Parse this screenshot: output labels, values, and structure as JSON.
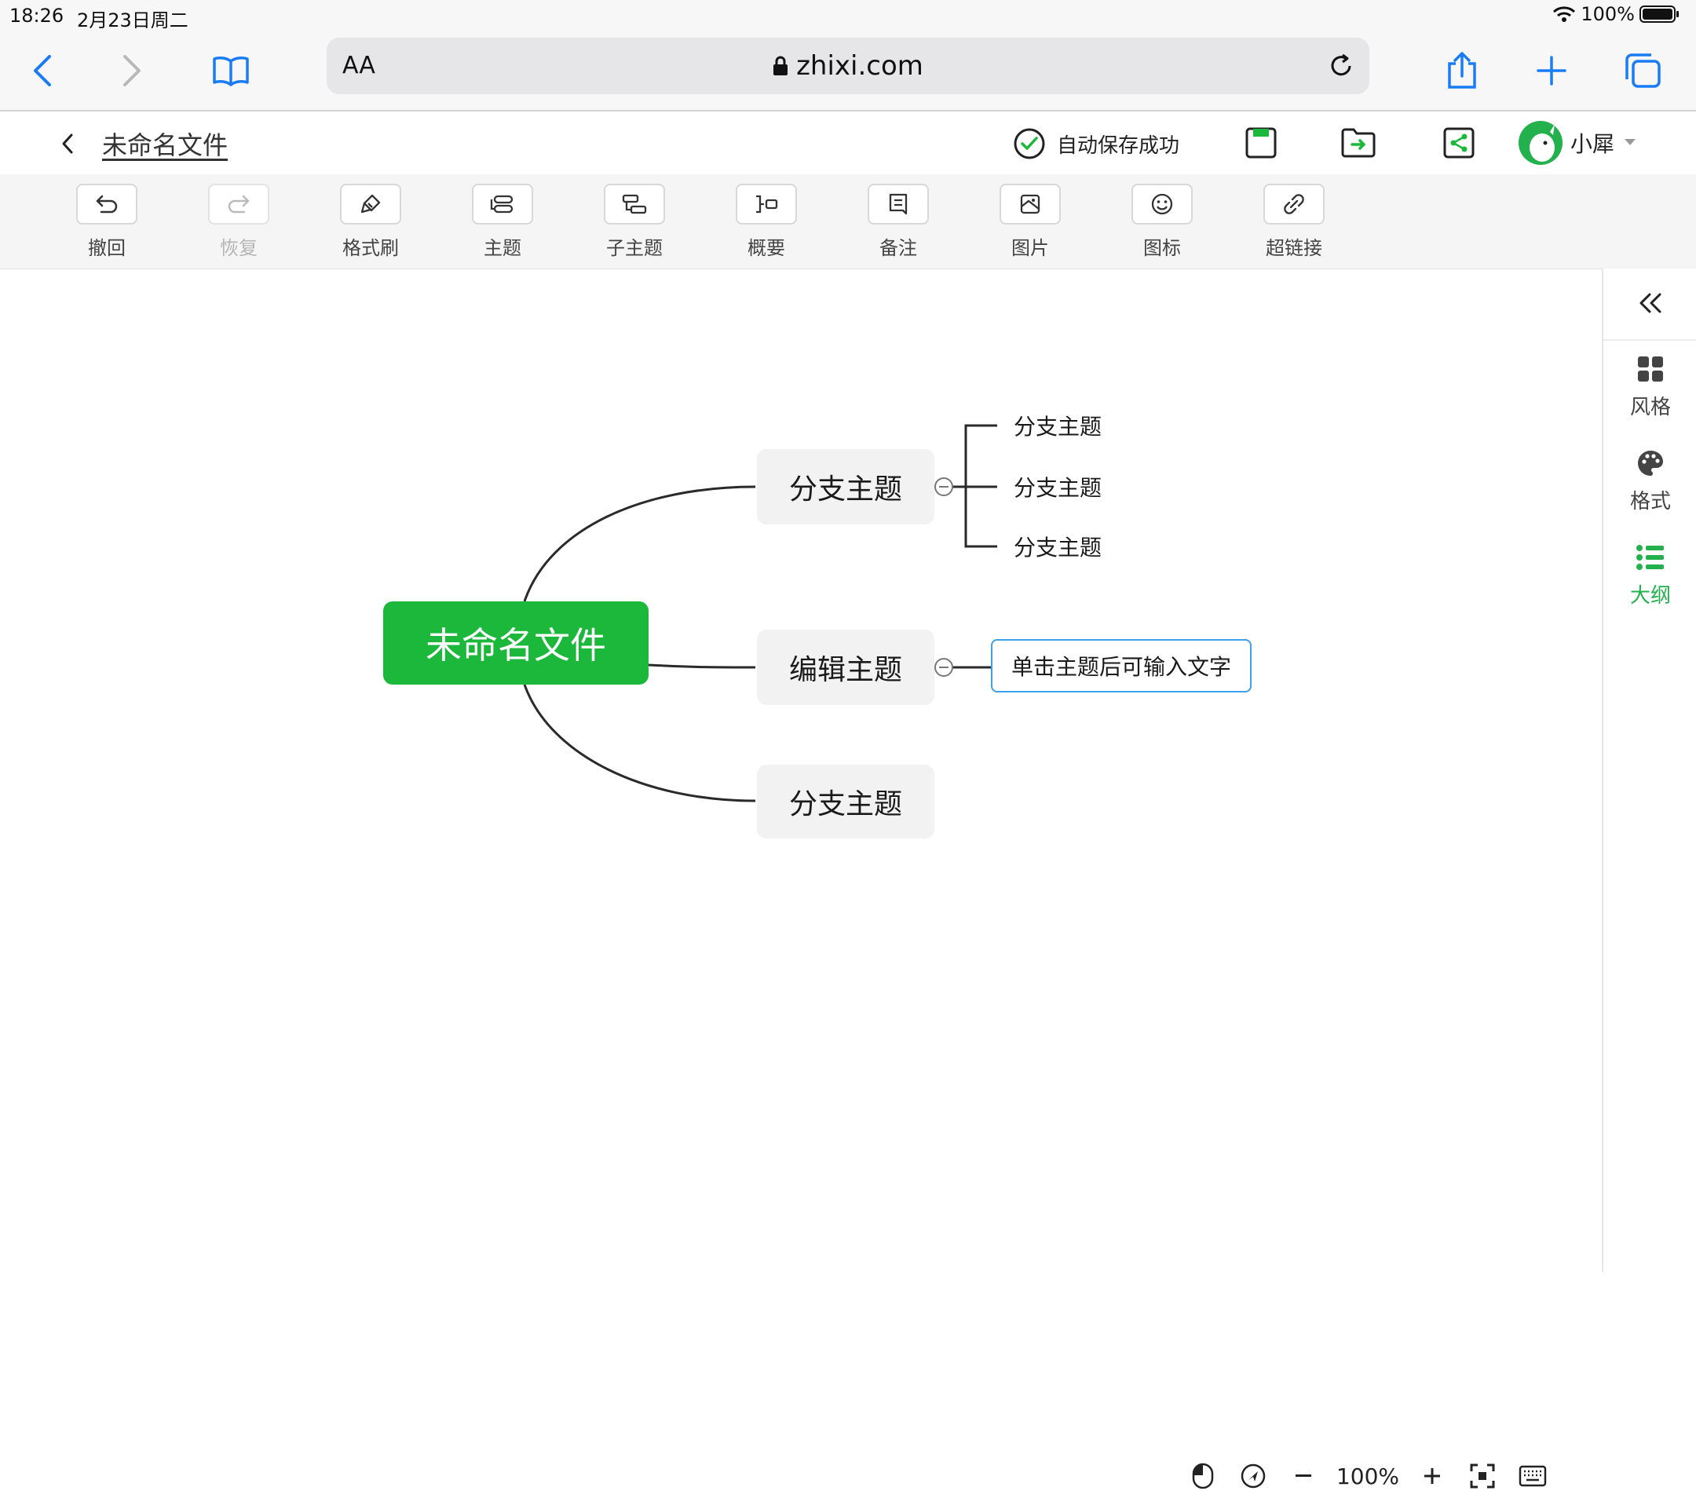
{
  "status_bar": {
    "time": "18:26",
    "date": "2月23日周二",
    "battery": "100%"
  },
  "browser": {
    "aa_label": "AA",
    "url": "zhixi.com"
  },
  "header": {
    "title": "未命名文件",
    "save_status": "自动保存成功",
    "user_name": "小犀"
  },
  "toolbar": {
    "items": [
      {
        "label": "撤回",
        "icon": "undo-icon",
        "enabled": true
      },
      {
        "label": "恢复",
        "icon": "redo-icon",
        "enabled": false
      },
      {
        "label": "格式刷",
        "icon": "format-brush-icon",
        "enabled": true
      },
      {
        "label": "主题",
        "icon": "topic-icon",
        "enabled": true
      },
      {
        "label": "子主题",
        "icon": "subtopic-icon",
        "enabled": true
      },
      {
        "label": "概要",
        "icon": "summary-icon",
        "enabled": true
      },
      {
        "label": "备注",
        "icon": "note-icon",
        "enabled": true
      },
      {
        "label": "图片",
        "icon": "image-icon",
        "enabled": true
      },
      {
        "label": "图标",
        "icon": "emoji-icon",
        "enabled": true
      },
      {
        "label": "超链接",
        "icon": "link-icon",
        "enabled": true
      }
    ]
  },
  "right_panel": {
    "items": [
      {
        "label": "风格",
        "icon": "grid-icon",
        "active": false
      },
      {
        "label": "格式",
        "icon": "palette-icon",
        "active": false
      },
      {
        "label": "大纲",
        "icon": "outline-icon",
        "active": true
      }
    ]
  },
  "mindmap": {
    "root": "未命名文件",
    "branch_1": "分支主题",
    "branch_1_children": [
      "分支主题",
      "分支主题",
      "分支主题"
    ],
    "branch_2": "编辑主题",
    "branch_2_note": "单击主题后可输入文字",
    "branch_3": "分支主题"
  },
  "zoom": {
    "level": "100%"
  },
  "colors": {
    "accent": "#1bb83b",
    "link_blue": "#1a7cf5",
    "note_border": "#3fa0ea"
  }
}
